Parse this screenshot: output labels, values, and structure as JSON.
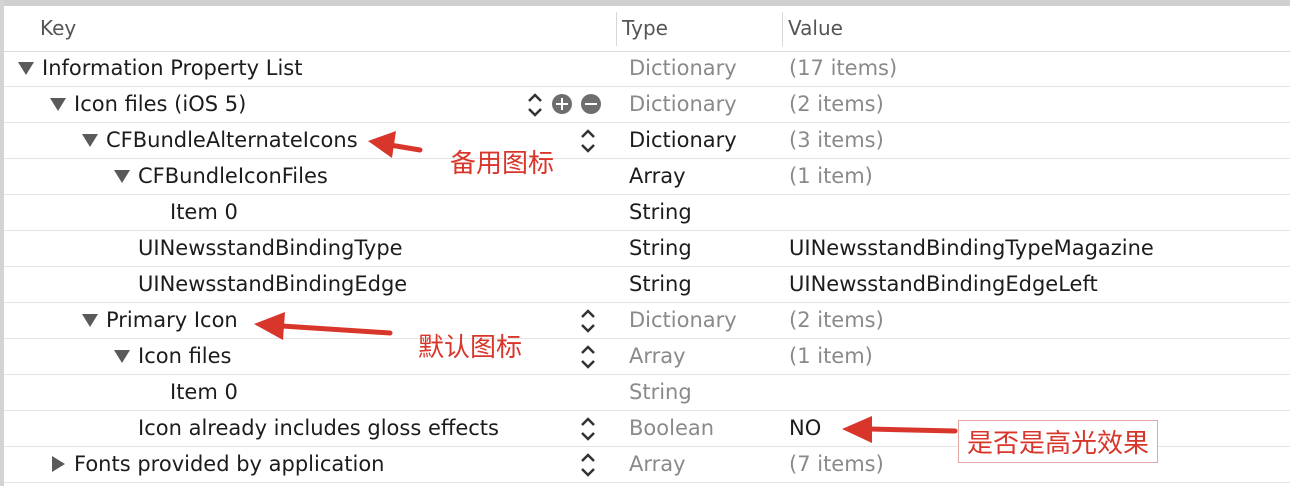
{
  "header": {
    "key": "Key",
    "type": "Type",
    "value": "Value"
  },
  "rows": [
    {
      "key": "Information Property List",
      "type": "Dictionary",
      "value": "(17 items)"
    },
    {
      "key": "Icon files (iOS 5)",
      "type": "Dictionary",
      "value": "(2 items)"
    },
    {
      "key": "CFBundleAlternateIcons",
      "type": "Dictionary",
      "value": "(3 items)"
    },
    {
      "key": "CFBundleIconFiles",
      "type": "Array",
      "value": "(1 item)"
    },
    {
      "key": "Item 0",
      "type": "String",
      "value": ""
    },
    {
      "key": "UINewsstandBindingType",
      "type": "String",
      "value": "UINewsstandBindingTypeMagazine"
    },
    {
      "key": "UINewsstandBindingEdge",
      "type": "String",
      "value": "UINewsstandBindingEdgeLeft"
    },
    {
      "key": "Primary Icon",
      "type": "Dictionary",
      "value": "(2 items)"
    },
    {
      "key": "Icon files",
      "type": "Array",
      "value": "(1 item)"
    },
    {
      "key": "Item 0",
      "type": "String",
      "value": ""
    },
    {
      "key": "Icon already includes gloss effects",
      "type": "Boolean",
      "value": "NO"
    },
    {
      "key": "Fonts provided by application",
      "type": "Array",
      "value": "(7 items)"
    }
  ],
  "annotations": {
    "alternate_icons": "备用图标",
    "primary_icon": "默认图标",
    "gloss": "是否是高光效果"
  },
  "colors": {
    "annotation": "#d9362b",
    "muted_text": "#8a8a8a"
  }
}
